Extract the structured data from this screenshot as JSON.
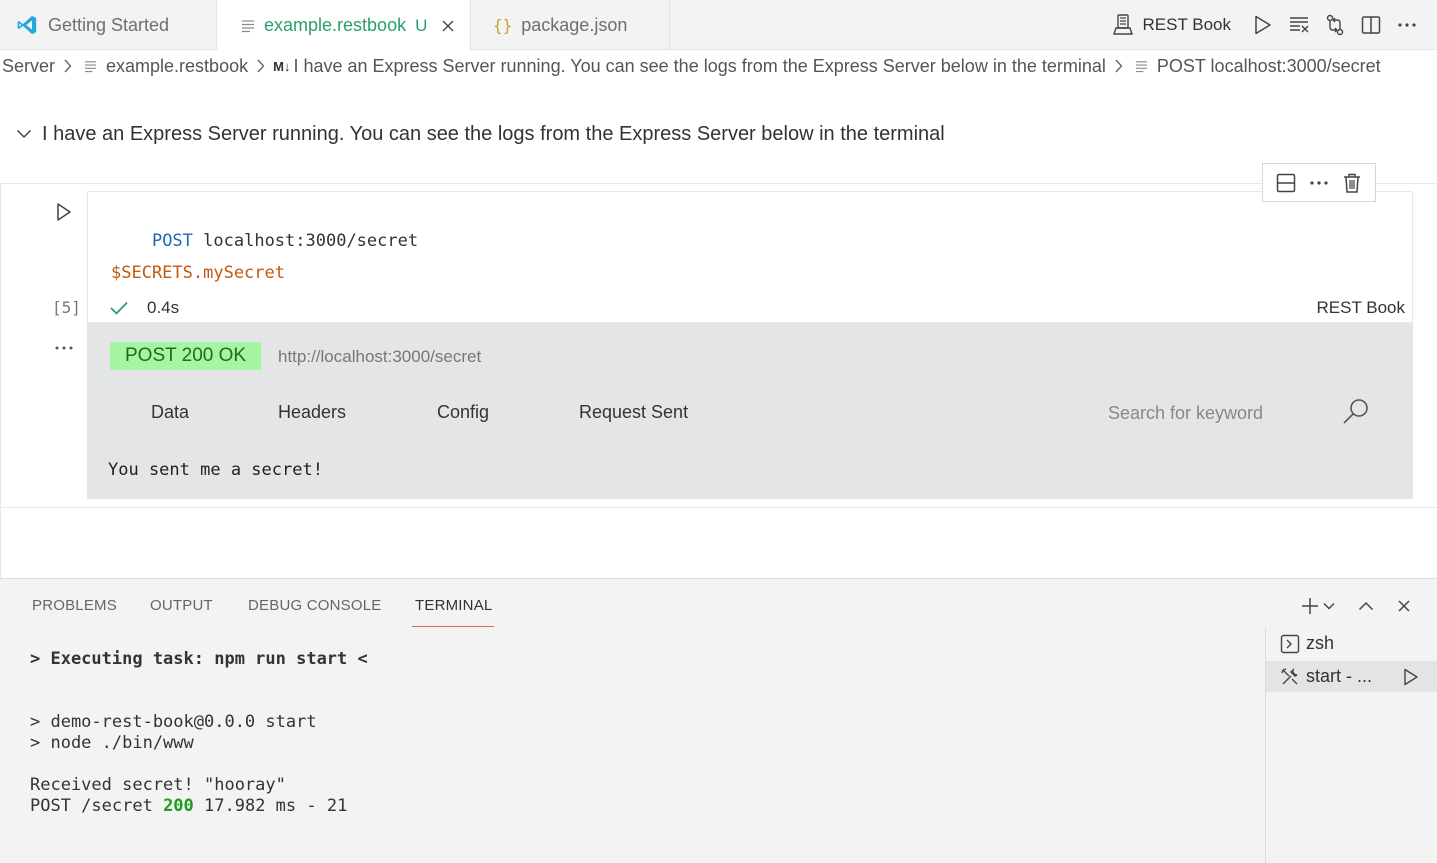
{
  "tabs": [
    {
      "label": "Getting Started",
      "icon": "vscode-logo-icon"
    },
    {
      "label": "example.restbook",
      "icon": "lines-file-icon",
      "badge": "U",
      "active": true
    },
    {
      "label": "package.json",
      "icon": "json-braces-icon"
    }
  ],
  "editor_actions": {
    "kernel_label": "REST Book"
  },
  "breadcrumb": [
    {
      "label": "Server",
      "icon": ""
    },
    {
      "label": "example.restbook",
      "icon": "lines-file-icon"
    },
    {
      "label": "I have an Express Server running. You can see the logs from the Express Server below in the terminal",
      "icon": "markdown-icon",
      "icon_text": "M↓"
    },
    {
      "label": "POST localhost:3000/secret",
      "icon": "lines-file-icon"
    }
  ],
  "markdown_cell": {
    "text": "I have an Express Server running. You can see the logs from the Express Server below in the terminal"
  },
  "code_cell": {
    "method": "POST",
    "url": "localhost:3000/secret",
    "body": "$SECRETS.mySecret",
    "execution_count": "[5]",
    "duration": "0.4s",
    "kernel": "REST Book",
    "more": "..."
  },
  "output": {
    "status": "POST 200 OK",
    "url": "http://localhost:3000/secret",
    "tabs": [
      "Data",
      "Headers",
      "Config",
      "Request Sent"
    ],
    "search_placeholder": "Search for keyword",
    "body": "You sent me a secret!"
  },
  "panel": {
    "tabs": [
      "PROBLEMS",
      "OUTPUT",
      "DEBUG CONSOLE",
      "TERMINAL"
    ],
    "active_tab": "TERMINAL",
    "terminal_lines": [
      "> Executing task: npm run start <",
      "> demo-rest-book@0.0.0 start",
      "> node ./bin/www",
      "Received secret! \"hooray\"",
      "POST /secret ",
      "200",
      " 17.982 ms - 21"
    ],
    "terminals": [
      {
        "label": "zsh",
        "icon": "terminal-icon"
      },
      {
        "label": "start - ...",
        "icon": "tools-icon",
        "selected": true
      }
    ]
  },
  "colors": {
    "accent_green": "#2aa06a",
    "status_badge_bg": "#a6f5a0",
    "output_bg": "#e4e5e7",
    "post_keyword": "#1f68b3",
    "secret_var": "#c05a12",
    "terminal_active_underline": "#e06a57"
  }
}
